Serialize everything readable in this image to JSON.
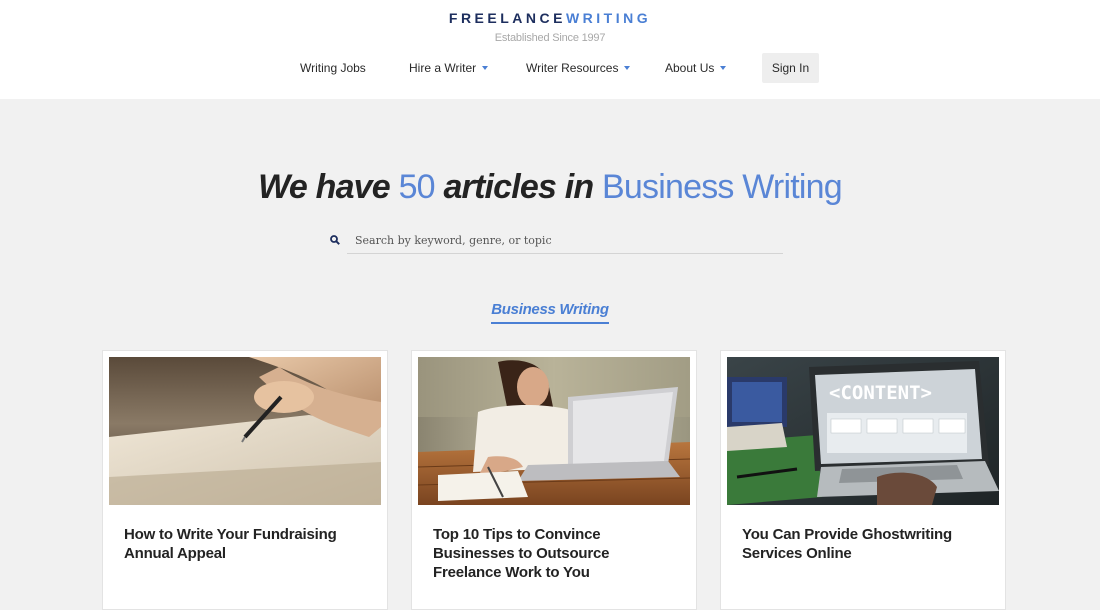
{
  "logo": {
    "part1": "FREELANCE",
    "part2": "WRITING",
    "tagline": "Established Since 1997"
  },
  "nav": {
    "items": [
      {
        "label": "Writing Jobs"
      },
      {
        "label": "Hire a Writer"
      },
      {
        "label": "Writer Resources"
      },
      {
        "label": "About Us"
      }
    ],
    "signin": "Sign In"
  },
  "hero": {
    "part1": "We have",
    "count": "50",
    "part2": "articles in",
    "category": "Business Writing"
  },
  "search": {
    "placeholder": "Search by keyword, genre, or topic",
    "icon": "search-icon"
  },
  "category_tab": {
    "label": "Business Writing"
  },
  "cards": [
    {
      "title": "How to Write Your Fundraising Annual Appeal"
    },
    {
      "title": "Top 10 Tips to Convince Businesses to Outsource Freelance Work to You"
    },
    {
      "title": "You Can Provide Ghostwriting Services Online"
    }
  ],
  "images": {
    "card3_screen_text": "<CONTENT>"
  },
  "colors": {
    "navy": "#1d2e5e",
    "accent": "#4a7fd4",
    "background": "#f1f1f1"
  }
}
